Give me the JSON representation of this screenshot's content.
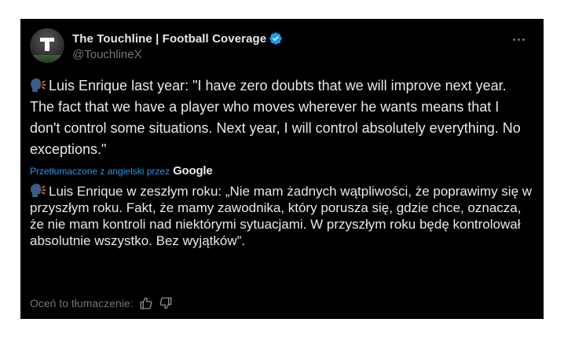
{
  "author": {
    "display_name": "The Touchline | Football Coverage",
    "handle": "@TouchlineX",
    "avatar_letter": "T",
    "verified_color": "#1d9bf0"
  },
  "tweet": {
    "text": "Luis Enrique last year: \"I have zero doubts that we will improve next year. The fact that we have a player who moves wherever he wants means that I don't control some situations. Next year, I will control absolutely everything. No exceptions.\""
  },
  "translation": {
    "credit_label": "Przetłumaczone z angielski przez",
    "provider": "Google",
    "text": "Luis Enrique w zeszłym roku: „Nie mam żadnych wątpliwości, że poprawimy się w przyszłym roku. Fakt, że mamy zawodnika, który porusza się, gdzie chce, oznacza, że nie mam kontroli nad niektórymi sytuacjami. W przyszłym roku będę kontrolował absolutnie wszystko. Bez wyjątków”.",
    "rate_label": "Oceń to tłumaczenie:"
  },
  "icons": {
    "speaking_head": "speaking-head-icon",
    "thumbs_up": "thumbs-up-icon",
    "thumbs_down": "thumbs-down-icon",
    "more": "more-icon"
  }
}
